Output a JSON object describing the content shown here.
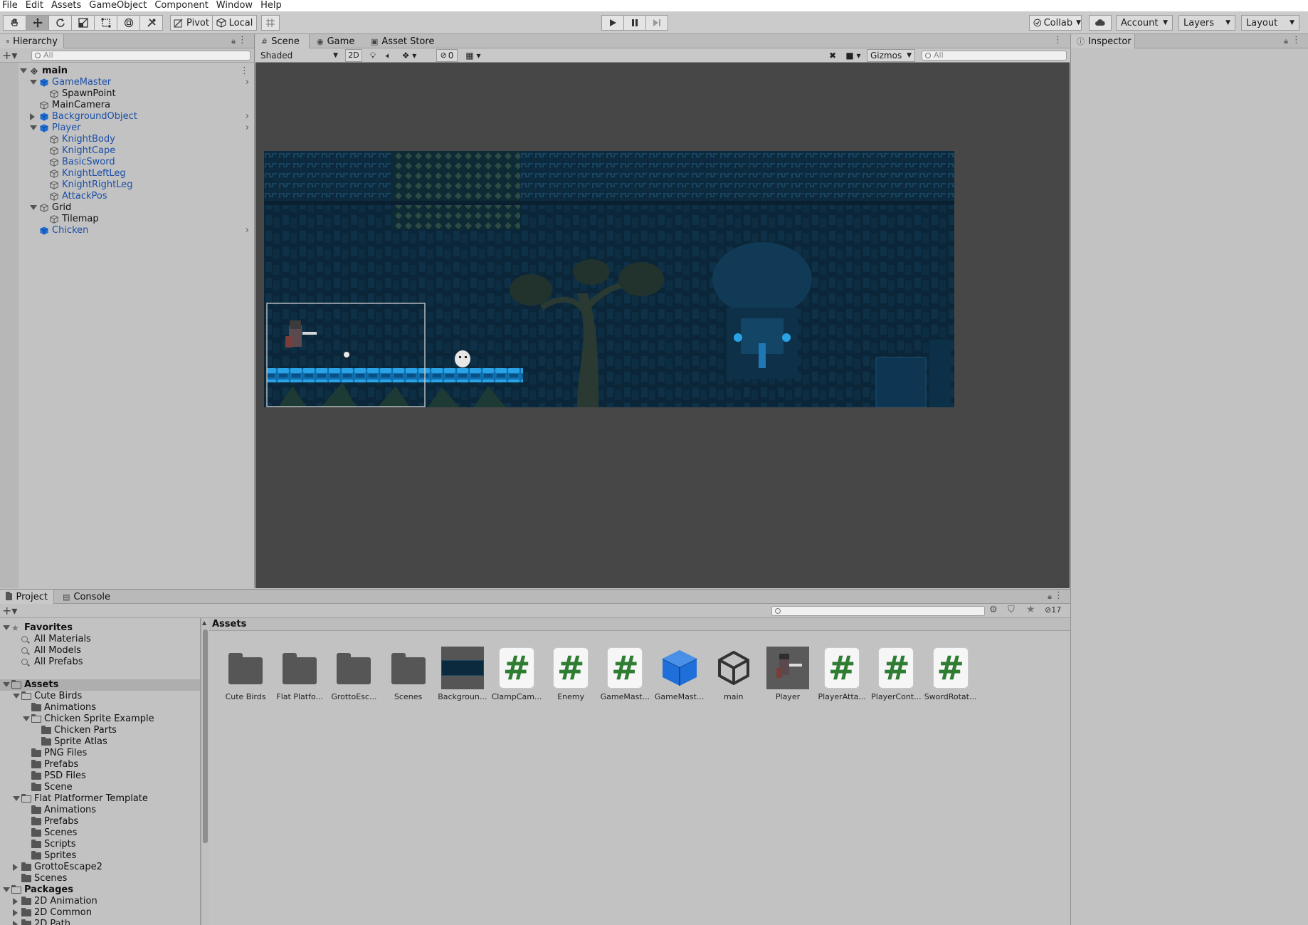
{
  "menu": [
    "File",
    "Edit",
    "Assets",
    "GameObject",
    "Component",
    "Window",
    "Help"
  ],
  "toolbar": {
    "pivot_label": "Pivot",
    "local_label": "Local",
    "collab_label": "Collab",
    "account_label": "Account",
    "layers_label": "Layers",
    "layout_label": "Layout"
  },
  "hierarchy": {
    "tab_label": "Hierarchy",
    "search_placeholder": "All",
    "rows": [
      {
        "label": "main",
        "depth": 0,
        "expanded": true,
        "icon": "scene-icon",
        "bold": true,
        "blue": false,
        "chevron": false
      },
      {
        "label": "GameMaster",
        "depth": 1,
        "expanded": true,
        "icon": "prefab-cube-icon",
        "blue": true,
        "chevron": true
      },
      {
        "label": "SpawnPoint",
        "depth": 2,
        "icon": "gameobject-cube-icon",
        "blue": false
      },
      {
        "label": "MainCamera",
        "depth": 1,
        "icon": "gameobject-cube-icon",
        "blue": false
      },
      {
        "label": "BackgroundObject",
        "depth": 1,
        "collapsed": true,
        "icon": "prefab-cube-icon",
        "blue": true,
        "chevron": true
      },
      {
        "label": "Player",
        "depth": 1,
        "expanded": true,
        "icon": "prefab-cube-icon",
        "blue": true,
        "chevron": true
      },
      {
        "label": "KnightBody",
        "depth": 2,
        "icon": "gameobject-cube-icon",
        "blue": true
      },
      {
        "label": "KnightCape",
        "depth": 2,
        "icon": "gameobject-cube-icon",
        "blue": true
      },
      {
        "label": "BasicSword",
        "depth": 2,
        "icon": "gameobject-cube-icon",
        "blue": true
      },
      {
        "label": "KnightLeftLeg",
        "depth": 2,
        "icon": "gameobject-cube-icon",
        "blue": true
      },
      {
        "label": "KnightRightLeg",
        "depth": 2,
        "icon": "gameobject-cube-icon",
        "blue": true
      },
      {
        "label": "AttackPos",
        "depth": 2,
        "icon": "gameobject-cube-icon",
        "blue": true
      },
      {
        "label": "Grid",
        "depth": 1,
        "expanded": true,
        "icon": "gameobject-cube-icon",
        "blue": false
      },
      {
        "label": "Tilemap",
        "depth": 2,
        "icon": "gameobject-cube-icon",
        "blue": false
      },
      {
        "label": "Chicken",
        "depth": 1,
        "icon": "prefab-cube-icon",
        "blue": true,
        "chevron": true
      }
    ]
  },
  "scene": {
    "tabs": [
      "Scene",
      "Game",
      "Asset Store"
    ],
    "shading_mode": "Shaded",
    "mode_2d": "2D",
    "hidden_count": "0",
    "gizmos_label": "Gizmos",
    "search_placeholder": "All"
  },
  "inspector": {
    "tab_label": "Inspector"
  },
  "project": {
    "tabs": [
      "Project",
      "Console"
    ],
    "hidden_count": "17",
    "assets_header": "Assets",
    "tree": [
      {
        "label": "Favorites",
        "depth": 0,
        "type": "star",
        "bold": true,
        "expanded": true
      },
      {
        "label": "All Materials",
        "depth": 1,
        "type": "search"
      },
      {
        "label": "All Models",
        "depth": 1,
        "type": "search"
      },
      {
        "label": "All Prefabs",
        "depth": 1,
        "type": "search"
      },
      {
        "label": "",
        "depth": 0,
        "type": "spacer"
      },
      {
        "label": "Assets",
        "depth": 0,
        "type": "folder-open",
        "bold": true,
        "expanded": true,
        "highlight": true
      },
      {
        "label": "Cute Birds",
        "depth": 1,
        "type": "folder-open",
        "expanded": true
      },
      {
        "label": "Animations",
        "depth": 2,
        "type": "folder"
      },
      {
        "label": "Chicken Sprite Example",
        "depth": 2,
        "type": "folder-open",
        "expanded": true
      },
      {
        "label": "Chicken Parts",
        "depth": 3,
        "type": "folder"
      },
      {
        "label": "Sprite Atlas",
        "depth": 3,
        "type": "folder"
      },
      {
        "label": "PNG Files",
        "depth": 2,
        "type": "folder"
      },
      {
        "label": "Prefabs",
        "depth": 2,
        "type": "folder"
      },
      {
        "label": "PSD Files",
        "depth": 2,
        "type": "folder"
      },
      {
        "label": "Scene",
        "depth": 2,
        "type": "folder"
      },
      {
        "label": "Flat Platformer Template",
        "depth": 1,
        "type": "folder-open",
        "expanded": true
      },
      {
        "label": "Animations",
        "depth": 2,
        "type": "folder"
      },
      {
        "label": "Prefabs",
        "depth": 2,
        "type": "folder"
      },
      {
        "label": "Scenes",
        "depth": 2,
        "type": "folder"
      },
      {
        "label": "Scripts",
        "depth": 2,
        "type": "folder"
      },
      {
        "label": "Sprites",
        "depth": 2,
        "type": "folder"
      },
      {
        "label": "GrottoEscape2",
        "depth": 1,
        "type": "folder",
        "collapsed": true
      },
      {
        "label": "Scenes",
        "depth": 1,
        "type": "folder"
      },
      {
        "label": "Packages",
        "depth": 0,
        "type": "folder-open",
        "bold": true,
        "expanded": true
      },
      {
        "label": "2D Animation",
        "depth": 1,
        "type": "folder",
        "collapsed": true
      },
      {
        "label": "2D Common",
        "depth": 1,
        "type": "folder",
        "collapsed": true
      },
      {
        "label": "2D Path",
        "depth": 1,
        "type": "folder",
        "collapsed": true
      }
    ],
    "assets": [
      {
        "label": "Cute Birds",
        "kind": "folder"
      },
      {
        "label": "Flat Platfo...",
        "kind": "folder"
      },
      {
        "label": "GrottoEsc...",
        "kind": "folder"
      },
      {
        "label": "Scenes",
        "kind": "folder"
      },
      {
        "label": "Backgroun...",
        "kind": "background-sprite"
      },
      {
        "label": "ClampCam...",
        "kind": "script"
      },
      {
        "label": "Enemy",
        "kind": "script"
      },
      {
        "label": "GameMast...",
        "kind": "script"
      },
      {
        "label": "GameMast...",
        "kind": "prefab"
      },
      {
        "label": "main",
        "kind": "unity-scene"
      },
      {
        "label": "Player",
        "kind": "player-sprite"
      },
      {
        "label": "PlayerAtta...",
        "kind": "script"
      },
      {
        "label": "PlayerCont...",
        "kind": "script"
      },
      {
        "label": "SwordRotat...",
        "kind": "script"
      }
    ]
  },
  "colors": {
    "prefab_blue": "#1a4fa8",
    "scene_bg": "#474747",
    "game_bg": "#0a2436",
    "script_green": "#2e7d32"
  }
}
